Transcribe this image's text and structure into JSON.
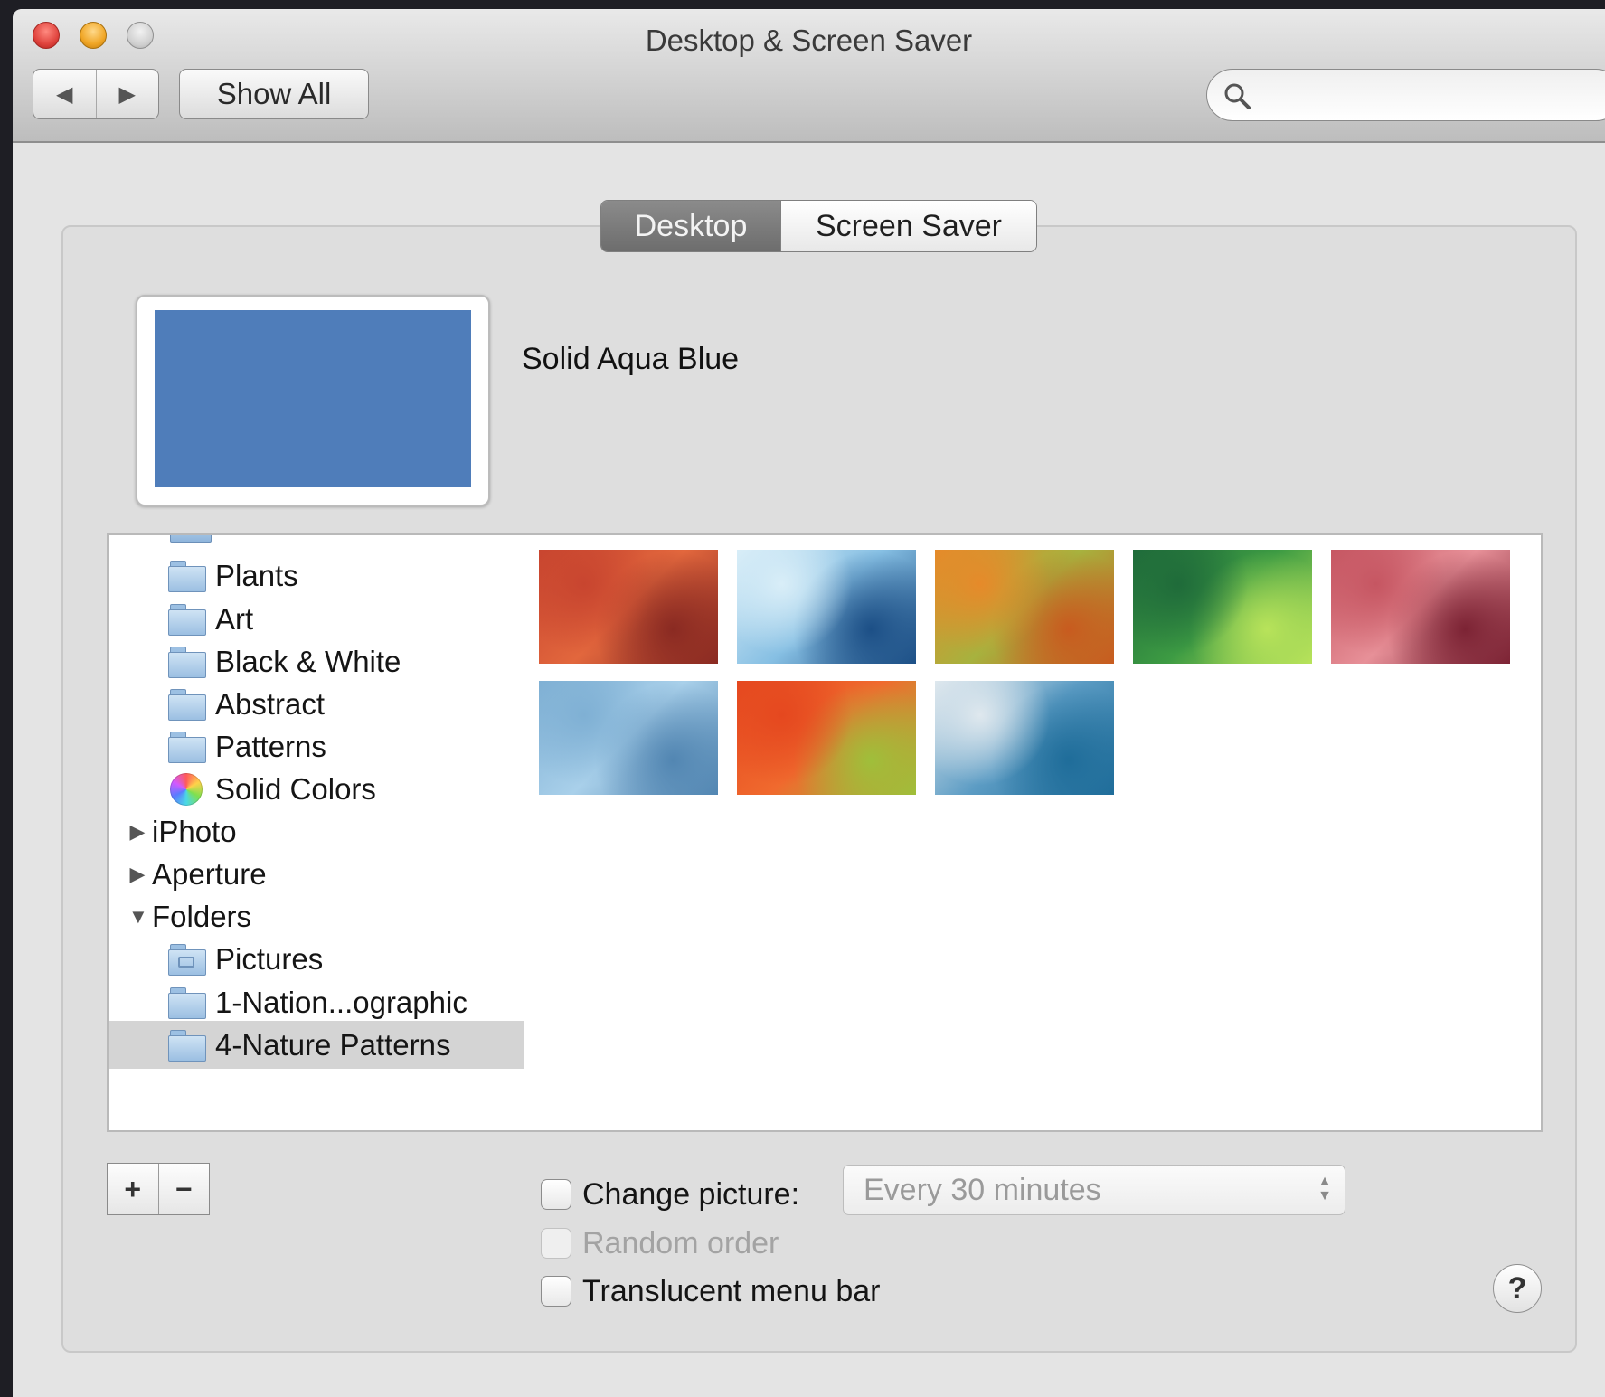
{
  "window": {
    "title": "Desktop & Screen Saver"
  },
  "toolbar": {
    "back_label": "◀",
    "forward_label": "▶",
    "show_all_label": "Show All",
    "search_value": "",
    "search_placeholder": ""
  },
  "tabs": [
    {
      "label": "Desktop",
      "selected": true
    },
    {
      "label": "Screen Saver",
      "selected": false
    }
  ],
  "preview": {
    "name": "Solid Aqua Blue",
    "color": "#4f7dba"
  },
  "source_list": {
    "items": [
      {
        "label": "Plants",
        "icon": "folder-icon",
        "level": 1
      },
      {
        "label": "Art",
        "icon": "folder-icon",
        "level": 1
      },
      {
        "label": "Black & White",
        "icon": "folder-icon",
        "level": 1
      },
      {
        "label": "Abstract",
        "icon": "folder-icon",
        "level": 1
      },
      {
        "label": "Patterns",
        "icon": "folder-icon",
        "level": 1
      },
      {
        "label": "Solid Colors",
        "icon": "color-wheel-icon",
        "level": 1
      },
      {
        "label": "iPhoto",
        "icon": "disclosure-right-icon",
        "level": 0
      },
      {
        "label": "Aperture",
        "icon": "disclosure-right-icon",
        "level": 0
      },
      {
        "label": "Folders",
        "icon": "disclosure-down-icon",
        "level": 0
      },
      {
        "label": "Pictures",
        "icon": "pictures-folder-icon",
        "level": 1
      },
      {
        "label": "1-Nation...ographic",
        "icon": "folder-icon",
        "level": 1
      },
      {
        "label": "4-Nature Patterns",
        "icon": "folder-icon",
        "level": 1,
        "selected": true
      }
    ]
  },
  "image_grid": {
    "thumbnails": [
      {
        "name": "autumn-forest",
        "colors": [
          "#c8452f",
          "#e2673d",
          "#8a2a22"
        ]
      },
      {
        "name": "ice-glacier",
        "colors": [
          "#d9eef8",
          "#86bfe3",
          "#1c4f86"
        ]
      },
      {
        "name": "eucalyptus-bark",
        "colors": [
          "#e68a2a",
          "#a7b23e",
          "#c85b1f"
        ]
      },
      {
        "name": "green-leaf",
        "colors": [
          "#1f6b3a",
          "#3d9b43",
          "#b8e35a"
        ]
      },
      {
        "name": "sandstone-waves",
        "colors": [
          "#c65662",
          "#e79098",
          "#7c2334"
        ]
      },
      {
        "name": "frost-pattern",
        "colors": [
          "#7fb0d4",
          "#a9d0ea",
          "#5286b2"
        ]
      },
      {
        "name": "red-leaf-veins",
        "colors": [
          "#e5481f",
          "#f06a2e",
          "#9fbf3a"
        ]
      },
      {
        "name": "misty-lake",
        "colors": [
          "#dfe8ee",
          "#5c9cc4",
          "#1f6d9a"
        ]
      }
    ]
  },
  "controls": {
    "add_label": "+",
    "remove_label": "−",
    "change_picture_label": "Change picture:",
    "change_picture_checked": false,
    "interval_value": "Every 30 minutes",
    "random_order_label": "Random order",
    "random_order_checked": false,
    "translucent_label": "Translucent menu bar",
    "translucent_checked": false,
    "help_label": "?"
  }
}
